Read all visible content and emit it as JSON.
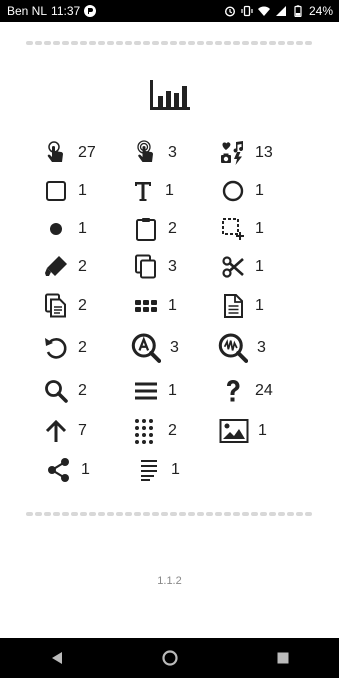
{
  "status": {
    "carrier": "Ben NL",
    "time": "11:37",
    "battery": "24%"
  },
  "items": [
    {
      "icon": "tap-icon",
      "count": "27"
    },
    {
      "icon": "double-tap-icon",
      "count": "3"
    },
    {
      "icon": "media-icon",
      "count": "13"
    },
    {
      "icon": "square-icon",
      "count": "1"
    },
    {
      "icon": "text-icon",
      "count": "1"
    },
    {
      "icon": "circle-icon",
      "count": "1"
    },
    {
      "icon": "dot-icon",
      "count": "1"
    },
    {
      "icon": "clipboard-icon",
      "count": "2"
    },
    {
      "icon": "select-add-icon",
      "count": "1"
    },
    {
      "icon": "eraser-icon",
      "count": "2"
    },
    {
      "icon": "copy-icon",
      "count": "3"
    },
    {
      "icon": "scissors-icon",
      "count": "1"
    },
    {
      "icon": "paste-icon",
      "count": "2"
    },
    {
      "icon": "keypad-icon",
      "count": "1"
    },
    {
      "icon": "document-icon",
      "count": "1"
    },
    {
      "icon": "undo-icon",
      "count": "2"
    },
    {
      "icon": "text-search-icon",
      "count": "3"
    },
    {
      "icon": "image-search-icon",
      "count": "3"
    },
    {
      "icon": "search-icon",
      "count": "2"
    },
    {
      "icon": "menu-icon",
      "count": "1"
    },
    {
      "icon": "help-icon",
      "count": "24"
    },
    {
      "icon": "arrow-up-icon",
      "count": "7"
    },
    {
      "icon": "dial-pad-icon",
      "count": "2"
    },
    {
      "icon": "image-icon",
      "count": "1"
    },
    {
      "icon": "share-icon",
      "count": "1"
    },
    {
      "icon": "text-lines-icon",
      "count": "1"
    }
  ],
  "version": "1.1.2"
}
